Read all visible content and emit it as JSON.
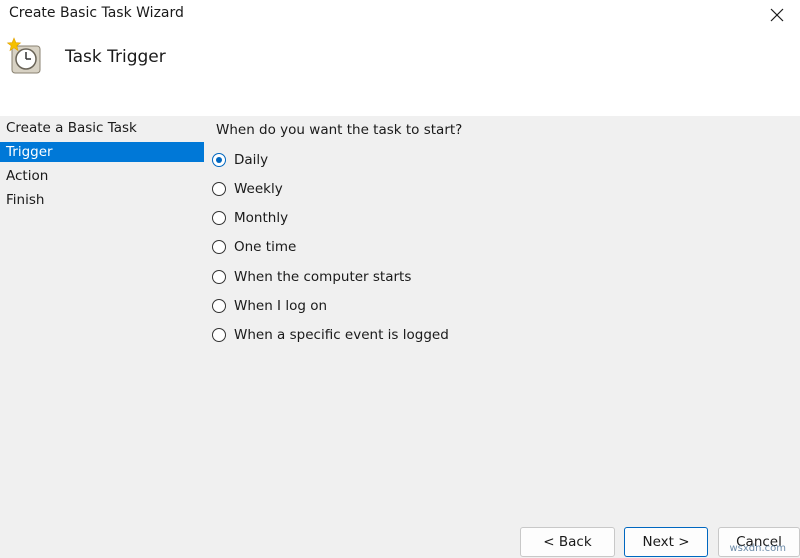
{
  "window": {
    "title": "Create Basic Task Wizard"
  },
  "header": {
    "title": "Task Trigger",
    "icon": "clock-task-icon"
  },
  "sidebar": {
    "steps": [
      {
        "label": "Create a Basic Task",
        "active": false
      },
      {
        "label": "Trigger",
        "active": true
      },
      {
        "label": "Action",
        "active": false
      },
      {
        "label": "Finish",
        "active": false
      }
    ]
  },
  "main": {
    "question": "When do you want the task to start?",
    "options": [
      {
        "label": "Daily",
        "selected": true
      },
      {
        "label": "Weekly",
        "selected": false
      },
      {
        "label": "Monthly",
        "selected": false
      },
      {
        "label": "One time",
        "selected": false
      },
      {
        "label": "When the computer starts",
        "selected": false
      },
      {
        "label": "When I log on",
        "selected": false
      },
      {
        "label": "When a specific event is logged",
        "selected": false
      }
    ]
  },
  "buttons": {
    "back": "< Back",
    "next": "Next >",
    "cancel": "Cancel"
  },
  "watermark": "wsxdn.com",
  "colors": {
    "accent": "#0078d7",
    "radio": "#0067c0"
  }
}
